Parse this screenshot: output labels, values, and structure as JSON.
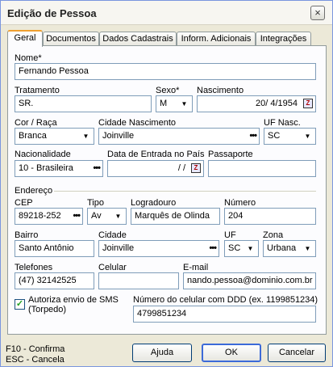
{
  "window": {
    "title": "Edição de Pessoa",
    "close_glyph": "×"
  },
  "tabs": [
    {
      "label": "Geral"
    },
    {
      "label": "Documentos"
    },
    {
      "label": "Dados Cadastrais"
    },
    {
      "label": "Inform. Adicionais"
    },
    {
      "label": "Integrações"
    }
  ],
  "form": {
    "nome": {
      "label": "Nome*",
      "value": "Fernando Pessoa"
    },
    "tratamento": {
      "label": "Tratamento",
      "value": "SR."
    },
    "sexo": {
      "label": "Sexo*",
      "value": "M"
    },
    "nascimento": {
      "label": "Nascimento",
      "value": "20/ 4/1954"
    },
    "cor_raca": {
      "label": "Cor / Raça",
      "value": "Branca"
    },
    "cidade_nascimento": {
      "label": "Cidade Nascimento",
      "value": "Joinville"
    },
    "uf_nasc": {
      "label": "UF Nasc.",
      "value": "SC"
    },
    "nacionalidade": {
      "label": "Nacionalidade",
      "value": "10 - Brasileira"
    },
    "data_entrada": {
      "label": "Data de Entrada no País",
      "value": "/ /"
    },
    "passaporte": {
      "label": "Passaporte",
      "value": ""
    },
    "endereco": {
      "label": "Endereço"
    },
    "cep": {
      "label": "CEP",
      "value": "89218-252"
    },
    "tipo": {
      "label": "Tipo",
      "value": "Av"
    },
    "logradouro": {
      "label": "Logradouro",
      "value": "Marquês de Olinda"
    },
    "numero": {
      "label": "Número",
      "value": "204"
    },
    "bairro": {
      "label": "Bairro",
      "value": "Santo Antônio"
    },
    "cidade": {
      "label": "Cidade",
      "value": "Joinville"
    },
    "uf": {
      "label": "UF",
      "value": "SC"
    },
    "zona": {
      "label": "Zona",
      "value": "Urbana"
    },
    "telefones": {
      "label": "Telefones",
      "value": "(47) 32142525"
    },
    "celular": {
      "label": "Celular",
      "value": ""
    },
    "email": {
      "label": "E-mail",
      "value": "nando.pessoa@dominio.com.br"
    },
    "sms": {
      "label_line1": "Autoriza envio de SMS",
      "label_line2": "(Torpedo)",
      "checked": true
    },
    "celular_ddd": {
      "label": "Número do celular com DDD (ex. 1199851234)",
      "value": "4799851234"
    }
  },
  "footer": {
    "hint1": "F10 - Confirma",
    "hint2": "ESC - Cancela",
    "help_label": "Ajuda",
    "ok_label": "OK",
    "cancel_label": "Cancelar"
  },
  "icons": {
    "combo": "▼",
    "lookup": "•••",
    "calendar": "Z",
    "check": "✓"
  }
}
